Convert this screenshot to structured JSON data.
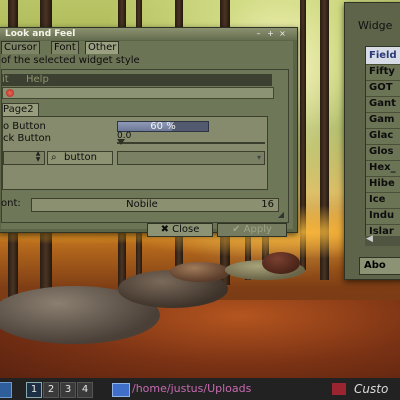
{
  "laf_window": {
    "title": "Look and Feel",
    "controls": [
      "–",
      "+",
      "×"
    ],
    "tabs": [
      "Cursor",
      "Font",
      "Other"
    ],
    "description": "of the selected widget style",
    "preview": {
      "menu": [
        "it",
        "Help"
      ],
      "page_tab": "Page2",
      "radio_label": "o Button",
      "check_label": "ck Button",
      "progress_text": "60 %",
      "progress_value": 0.6,
      "slider_value": "0.0",
      "search_button": "button"
    },
    "font_label": "ont:",
    "font_name": "Nobile",
    "font_size": "16",
    "close_button": "Close",
    "apply_button": "Apply"
  },
  "widget_window": {
    "title": "Widge",
    "themes": [
      "Field",
      "Fifty",
      "GOT",
      "Gant",
      "Gam",
      "Glac",
      "Glos",
      "Hex_",
      "Hibe",
      "Ice",
      "Indu",
      "Islar"
    ],
    "selected_theme": 0,
    "about_button": "Abo"
  },
  "taskbar": {
    "workspaces": [
      "1",
      "2",
      "3",
      "4"
    ],
    "active_workspace": 0,
    "folder_task": "/home/justus/Uploads",
    "custom_task": "Custo"
  }
}
